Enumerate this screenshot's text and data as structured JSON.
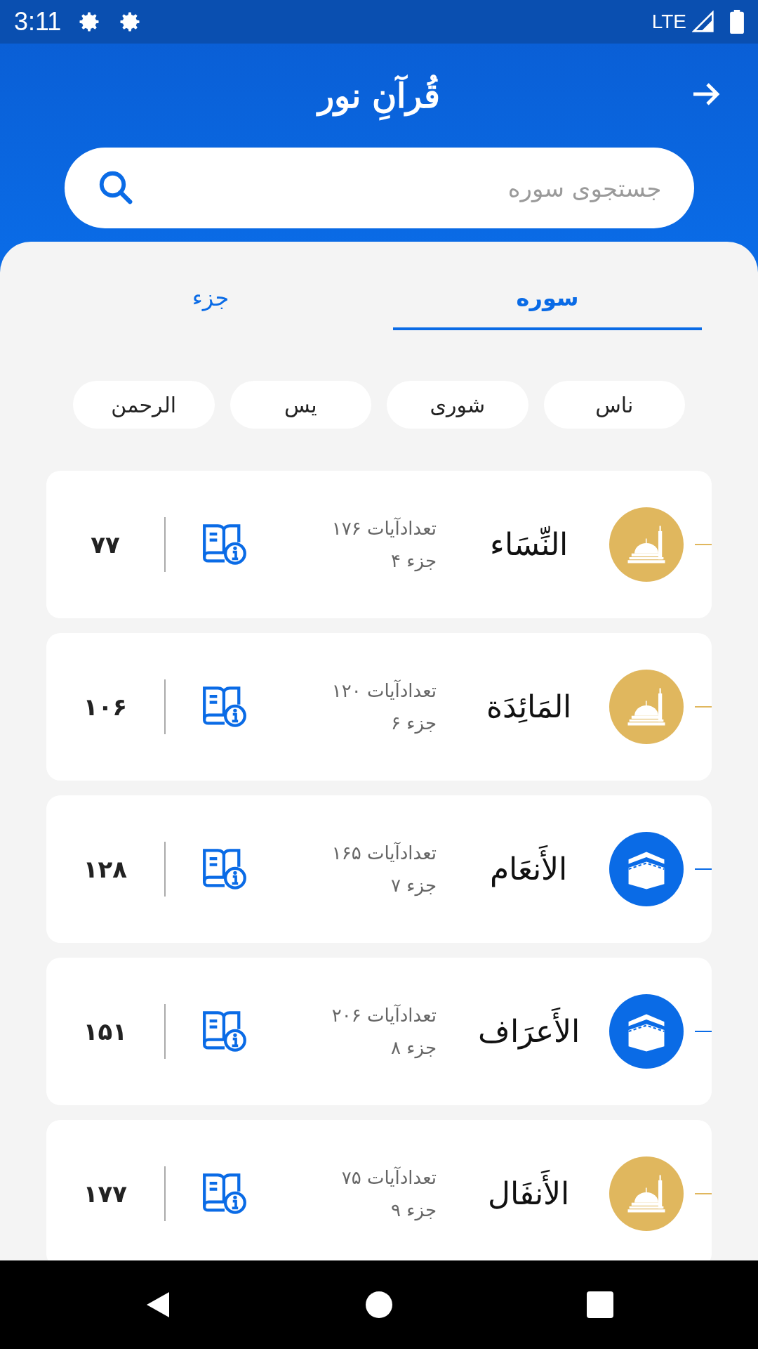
{
  "status_bar": {
    "time": "3:11",
    "network": "LTE"
  },
  "header": {
    "logo": "قُرآنِ نور",
    "search": {
      "placeholder": "جستجوی سوره"
    }
  },
  "tabs": [
    {
      "label": "سوره",
      "selected": true
    },
    {
      "label": "جزء",
      "selected": false
    }
  ],
  "chips": [
    "ناس",
    "شوری",
    "یس",
    "الرحمن"
  ],
  "surahs": [
    {
      "name": "النِّسَاء",
      "kind": "medinan",
      "verses": "تعدادآیات ۱۷۶",
      "juz": "جزء ۴",
      "page": "۷۷"
    },
    {
      "name": "المَائِدَة",
      "kind": "medinan",
      "verses": "تعدادآیات ۱۲۰",
      "juz": "جزء ۶",
      "page": "۱۰۶"
    },
    {
      "name": "الأَنعَام",
      "kind": "meccan",
      "verses": "تعدادآیات ۱۶۵",
      "juz": "جزء ۷",
      "page": "۱۲۸"
    },
    {
      "name": "الأَعرَاف",
      "kind": "meccan",
      "verses": "تعدادآیات ۲۰۶",
      "juz": "جزء ۸",
      "page": "۱۵۱"
    },
    {
      "name": "الأَنفَال",
      "kind": "medinan",
      "verses": "تعدادآیات ۷۵",
      "juz": "جزء ۹",
      "page": "۱۷۷"
    }
  ]
}
